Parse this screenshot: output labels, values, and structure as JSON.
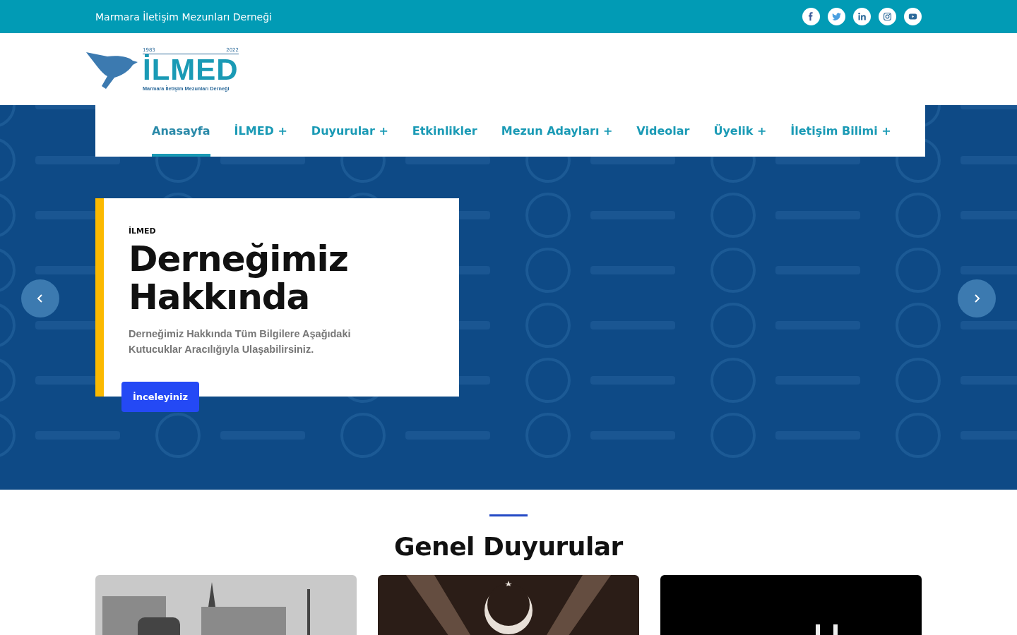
{
  "topbar": {
    "title": "Marmara İletişim Mezunları Derneği",
    "social": [
      {
        "kind": "facebook"
      },
      {
        "kind": "twitter"
      },
      {
        "kind": "linkedin"
      },
      {
        "kind": "instagram"
      },
      {
        "kind": "youtube"
      }
    ]
  },
  "logo": {
    "start_year": "1983",
    "end_year": "2022",
    "name": "İLMED",
    "subtitle": "Marmara İletişim Mezunları Derneği"
  },
  "nav": [
    {
      "label": "Anasayfa",
      "selected": true
    },
    {
      "label": "İLMED +",
      "selected": false
    },
    {
      "label": "Duyurular +",
      "selected": false
    },
    {
      "label": "Etkinlikler",
      "selected": false
    },
    {
      "label": "Mezun Adayları +",
      "selected": false
    },
    {
      "label": "Videolar",
      "selected": false
    },
    {
      "label": "Üyelik +",
      "selected": false
    },
    {
      "label": "İletişim Bilimi +",
      "selected": false
    }
  ],
  "hero": {
    "kicker": "İLMED",
    "title_line_1": "Derneğimiz",
    "title_line_2": "Hakkında",
    "text": "Derneğimiz Hakkında Tüm Bilgilere Aşağıdaki Kutucuklar Aracılığıyla Ulaşabilirsiniz.",
    "button": "İnceleyiniz"
  },
  "section": {
    "title": "Genel Duyurular"
  }
}
